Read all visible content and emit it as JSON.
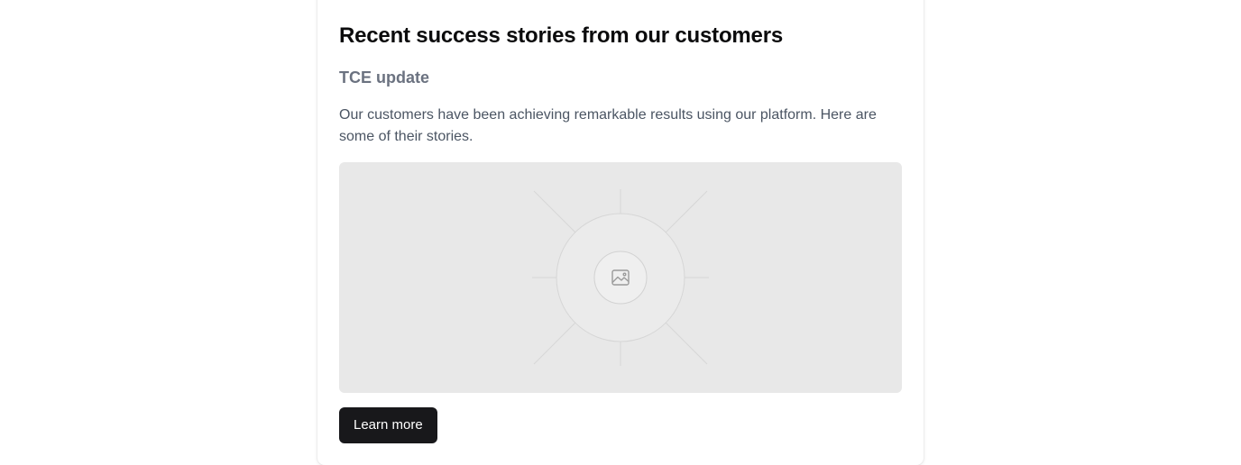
{
  "card": {
    "title": "Recent success stories from our customers",
    "subtitle": "TCE update",
    "body": "Our customers have been achieving remarkable results using our platform. Here are some of their stories.",
    "image": {
      "icon": "image-icon",
      "background_color": "#e8e8e8"
    },
    "cta_label": "Learn more",
    "cta_color": "#18181b"
  }
}
